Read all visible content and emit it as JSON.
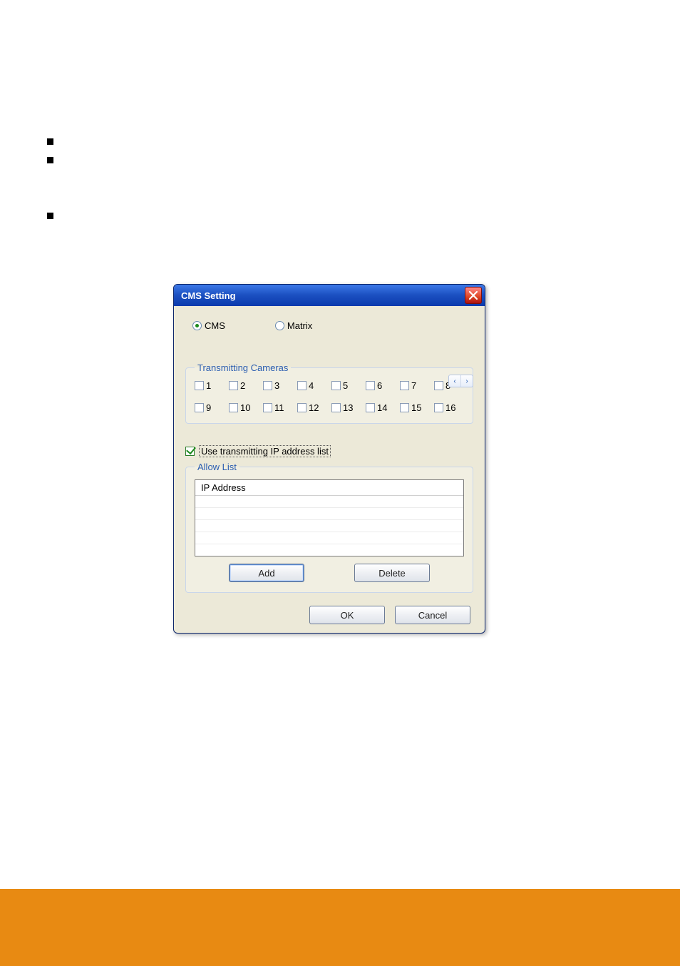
{
  "dialog": {
    "title": "CMS Setting",
    "mode": {
      "options": [
        {
          "label": "CMS",
          "checked": true
        },
        {
          "label": "Matrix",
          "checked": false
        }
      ]
    },
    "pager": {
      "prev": "‹",
      "next": "›"
    },
    "cameras": {
      "legend": "Transmitting Cameras",
      "items": [
        "1",
        "2",
        "3",
        "4",
        "5",
        "6",
        "7",
        "8",
        "9",
        "10",
        "11",
        "12",
        "13",
        "14",
        "15",
        "16"
      ]
    },
    "useList": {
      "label": "Use transmitting IP address list",
      "checked": true
    },
    "allowList": {
      "legend": "Allow List",
      "columnHeader": "IP Address",
      "rows": []
    },
    "buttons": {
      "add": "Add",
      "delete": "Delete",
      "ok": "OK",
      "cancel": "Cancel"
    }
  }
}
